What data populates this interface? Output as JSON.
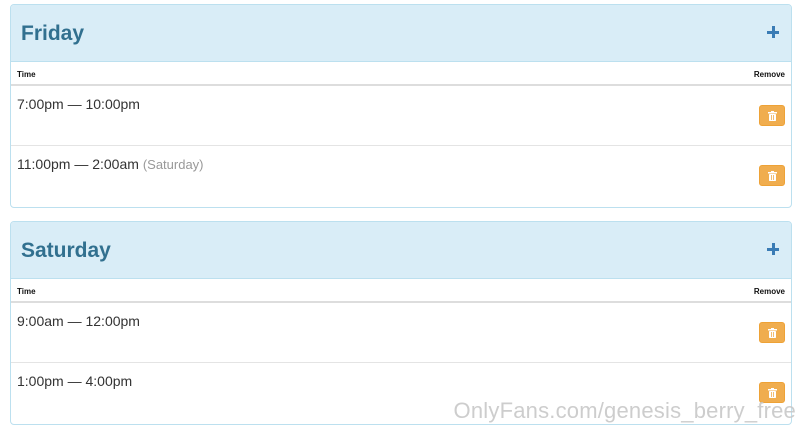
{
  "days": [
    {
      "title": "Friday",
      "add_icon": "plus-icon",
      "columns": {
        "time": "Time",
        "remove": "Remove"
      },
      "rows": [
        {
          "time": "7:00pm — 10:00pm",
          "note": ""
        },
        {
          "time": "11:00pm — 2:00am",
          "note": "(Saturday)"
        }
      ]
    },
    {
      "title": "Saturday",
      "add_icon": "plus-icon",
      "columns": {
        "time": "Time",
        "remove": "Remove"
      },
      "rows": [
        {
          "time": "9:00am — 12:00pm",
          "note": ""
        },
        {
          "time": "1:00pm — 4:00pm",
          "note": ""
        }
      ]
    }
  ],
  "remove_icon": "trash-icon",
  "colors": {
    "header_bg": "#d9edf7",
    "title": "#31708f",
    "add_icon": "#3a7cb5",
    "remove_button": "#f0ad4e"
  },
  "watermark": "OnlyFans.com/genesis_berry_free"
}
